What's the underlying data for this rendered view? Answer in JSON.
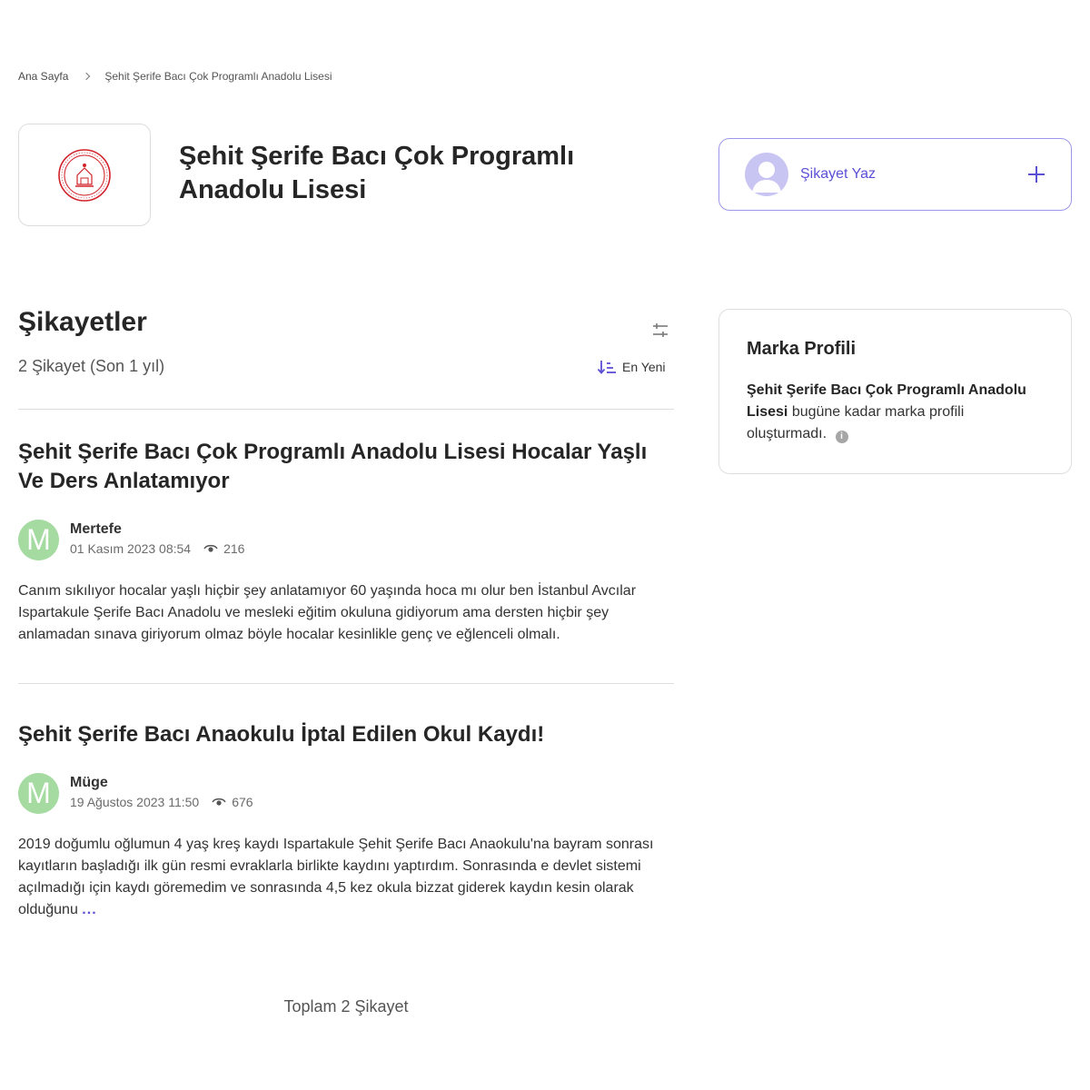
{
  "breadcrumb": {
    "home": "Ana Sayfa",
    "current": "Şehit Şerife Bacı Çok Programlı Anadolu Lisesi"
  },
  "company": {
    "title": "Şehit Şerife Bacı Çok Programlı Anadolu Lisesi",
    "logo_icon": "meb-seal-icon"
  },
  "write_complaint": {
    "label": "Şikayet Yaz"
  },
  "complaints_section": {
    "title": "Şikayetler",
    "subtitle": "2 Şikayet (Son 1 yıl)",
    "sort_label": "En Yeni"
  },
  "complaints": [
    {
      "title": "Şehit Şerife Bacı Çok Programlı Anadolu Lisesi Hocalar Yaşlı Ve Ders Anlatamıyor",
      "avatar_letter": "M",
      "user": "Mertefe",
      "date": "01 Kasım 2023 08:54",
      "views": "216",
      "body": "Canım sıkılıyor hocalar yaşlı hiçbir şey anlatamıyor 60 yaşında hoca mı olur ben İstanbul Avcılar Ispartakule Şerife Bacı Anadolu ve mesleki eğitim okuluna gidiyorum ama dersten hiçbir şey anlamadan sınava giriyorum olmaz böyle hocalar kesinlikle genç ve eğlenceli olmalı."
    },
    {
      "title": "Şehit Şerife Bacı Anaokulu İptal Edilen Okul Kaydı!",
      "avatar_letter": "M",
      "user": "Müge",
      "date": "19 Ağustos 2023 11:50",
      "views": "676",
      "body": "2019 doğumlu oğlumun 4 yaş kreş kaydı Ispartakule Şehit Şerife Bacı Anaokulu'na bayram sonrası kayıtların başladığı ilk gün resmi evraklarla birlikte kaydını yaptırdım. Sonrasında e devlet sistemi açılmadığı için kaydı göremedim ve sonrasında 4,5 kez okula bizzat giderek kaydın kesin olarak olduğunu",
      "more": "..."
    }
  ],
  "total": "Toplam 2 Şikayet",
  "brand_profile": {
    "title": "Marka Profili",
    "company_name": "Şehit Şerife Bacı Çok Programlı Anadolu Lisesi",
    "text": "bugüne kadar marka profili oluşturmadı.",
    "info": "i"
  },
  "colors": {
    "accent": "#5b4fd6",
    "avatar_green": "#a5dba1",
    "seal_red": "#d2232a"
  }
}
